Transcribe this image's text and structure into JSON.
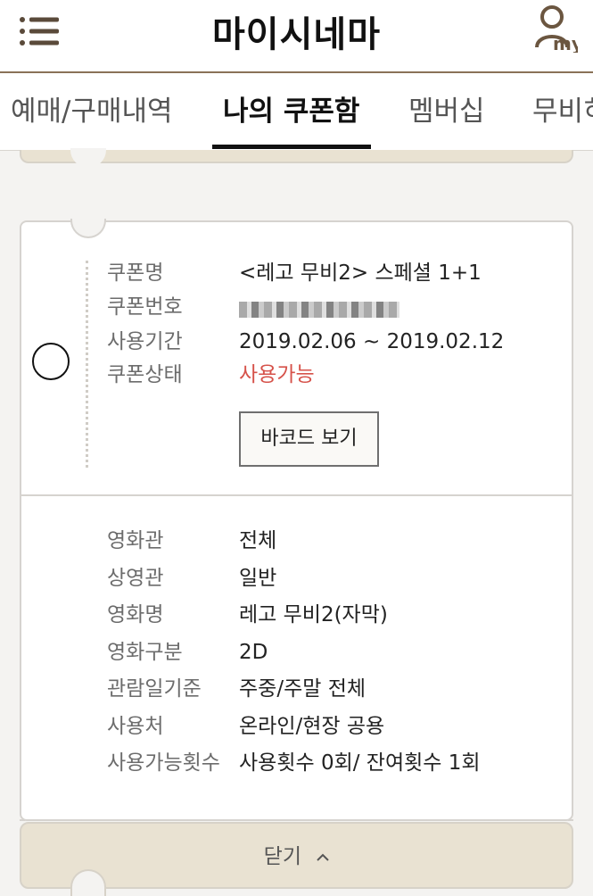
{
  "header": {
    "title": "마이시네마",
    "my_label": "my",
    "menu_icon": "hamburger-icon",
    "user_icon": "user-icon"
  },
  "tabs": [
    {
      "label": "예매/구매내역",
      "active": false
    },
    {
      "label": "나의 쿠폰함",
      "active": true
    },
    {
      "label": "멤버십",
      "active": false
    },
    {
      "label": "무비히",
      "active": false
    }
  ],
  "coupon": {
    "rows": [
      {
        "label": "쿠폰명",
        "value": "<레고 무비2> 스페셜 1+1"
      },
      {
        "label": "쿠폰번호",
        "value": ""
      },
      {
        "label": "사용기간",
        "value": "2019.02.06 ~ 2019.02.12"
      },
      {
        "label": "쿠폰상태",
        "value": "사용가능"
      }
    ],
    "barcode_button": "바코드 보기",
    "details": [
      {
        "label": "영화관",
        "value": "전체"
      },
      {
        "label": "상영관",
        "value": "일반"
      },
      {
        "label": "영화명",
        "value": "레고 무비2(자막)"
      },
      {
        "label": "영화구분",
        "value": "2D"
      },
      {
        "label": "관람일기준",
        "value": "주중/주말 전체"
      },
      {
        "label": "사용처",
        "value": "온라인/현장 공용"
      },
      {
        "label": "사용가능횟수",
        "value": "사용횟수 0회/ 잔여횟수 1회"
      }
    ]
  },
  "close_bar": {
    "label": "닫기"
  },
  "colors": {
    "accent_brown": "#8a7257",
    "status_red": "#d6524a",
    "ticket_beige": "#e9e2d2"
  }
}
